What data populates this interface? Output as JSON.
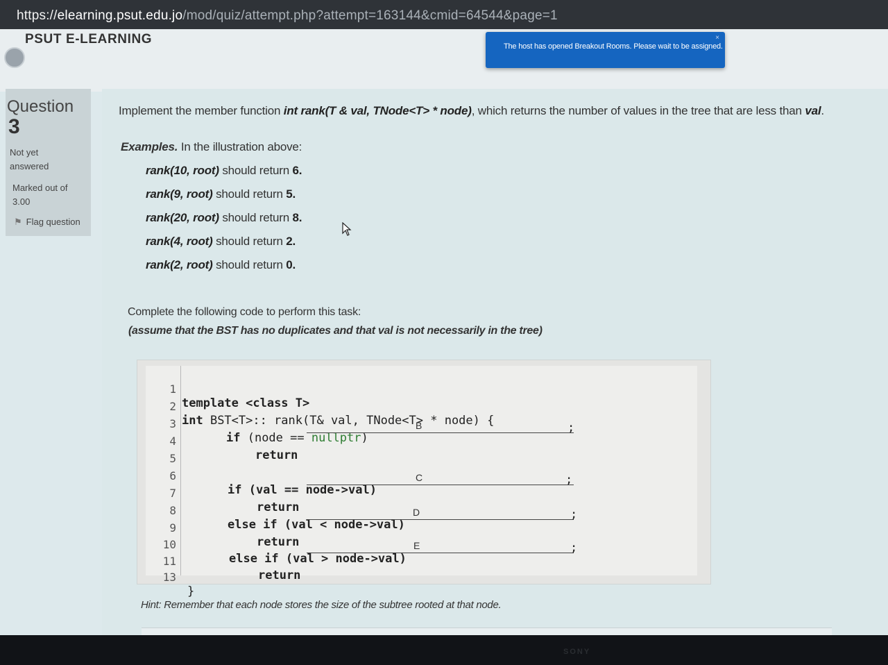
{
  "browser": {
    "url_scheme": "https://",
    "url_host": "elearning.psut.edu.jo",
    "url_path": "/mod/quiz/attempt.php?attempt=163144&cmid=64544&page=1"
  },
  "site": {
    "name": "PSUT E-LEARNING"
  },
  "notification": {
    "message": "The host has opened Breakout Rooms. Please wait to be assigned.",
    "close": "×"
  },
  "question_info": {
    "label": "Question",
    "number": "3",
    "status": "Not yet answered",
    "marks": "Marked out of 3.00",
    "flag": "Flag question"
  },
  "question": {
    "intro": "Implement the member function",
    "signature": "int rank(T & val, TNode<T> * node)",
    "middle": ", which returns the number of values in the tree that are less than",
    "val": "val",
    "end": ".",
    "examples_label": "Examples.",
    "examples_rest": "In the illustration above:",
    "examples": [
      {
        "call": "rank(10, root)",
        "text": "should return",
        "result": "6."
      },
      {
        "call": "rank(9, root)",
        "text": "should return",
        "result": "5."
      },
      {
        "call": "rank(20, root)",
        "text": "should return",
        "result": "8."
      },
      {
        "call": "rank(4, root)",
        "text": "should return",
        "result": "2."
      },
      {
        "call": "rank(2, root)",
        "text": "should return",
        "result": "0."
      }
    ],
    "complete": "Complete the following code to perform this task:",
    "assume": "(assume that the BST has no duplicates and that val is not necessarily in the tree)"
  },
  "code": {
    "line_numbers": [
      "1",
      "2",
      "3",
      "4",
      "5",
      "6",
      "7",
      "8",
      "9",
      "10",
      "11",
      "13"
    ],
    "l1_kw": "template",
    "l1_rest": " <class T>",
    "l2_kw": "int",
    "l2_rest": " BST<T>:: rank(T& val, TNode<T> * node) {",
    "l3_kw": "if",
    "l3_rest": " (node == ",
    "l3_null": "nullptr",
    "l3_close": ")",
    "l4": "return",
    "l6": "if (val == node->val)",
    "l7": "return",
    "l8": "else if (val < node->val)",
    "l9": "return",
    "l10": "else if (val > node->val)",
    "l11": "return",
    "l13": "}",
    "blanks": [
      "B",
      "C",
      "D",
      "E"
    ],
    "semicolon": ";"
  },
  "hint": "Hint: Remember that each node stores the size of the subtree rooted at that node.",
  "monitor": {
    "brand": "SONY"
  }
}
